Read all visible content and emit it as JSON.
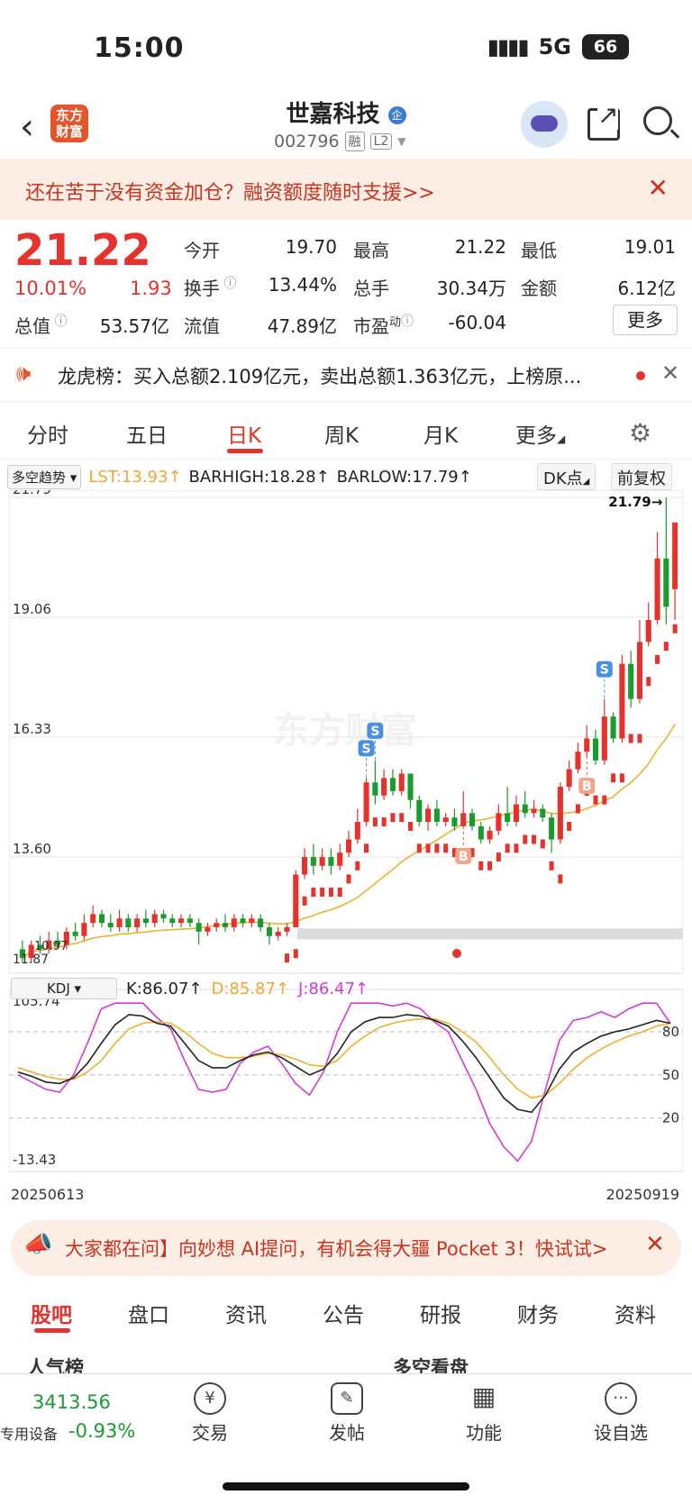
{
  "status": {
    "time": "15:00",
    "network": "5G",
    "battery": "66"
  },
  "header": {
    "logo": "东方财富",
    "name": "世嘉科技",
    "name_badge": "企",
    "code": "002796",
    "tag1": "融",
    "tag2": "L2"
  },
  "banner": {
    "text": "还在苦于没有资金加仓？融资额度随时支援>>",
    "close": "✕"
  },
  "quote": {
    "price": "21.22",
    "pct": "10.01%",
    "change": "1.93",
    "open_label": "今开",
    "open": "19.70",
    "high_label": "最高",
    "high": "21.22",
    "low_label": "最低",
    "low": "19.01",
    "turnover_label": "换手",
    "turnover": "13.44%",
    "volume_label": "总手",
    "volume": "30.34万",
    "amount_label": "金额",
    "amount": "6.12亿",
    "mcap_label": "总值",
    "mcap": "53.57亿",
    "float_label": "流值",
    "float": "47.89亿",
    "pe_label": "市盈",
    "pe_sup": "动",
    "pe": "-60.04",
    "more": "更多"
  },
  "notice": {
    "text": "龙虎榜：买入总额2.109亿元，卖出总额1.363亿元，上榜原...",
    "close": "✕"
  },
  "period_tabs": [
    "分时",
    "五日",
    "日K",
    "周K",
    "月K",
    "更多"
  ],
  "indicator": {
    "selector": "多空趋势",
    "lst": "LST:13.93↑",
    "barhigh": "BARHIGH:18.28↑",
    "barlow": "BARLOW:17.79↑",
    "dk": "DK点",
    "adjust": "前复权"
  },
  "chart_data": {
    "type": "candlestick",
    "watermark": "东方财富",
    "y_ticks": [
      "21.79",
      "19.06",
      "16.33",
      "13.60"
    ],
    "bottom_label": "11.87",
    "low_marker": "10.97",
    "high_marker": "21.79→",
    "ylim": [
      11.2,
      21.79
    ],
    "candles": [
      [
        11.5,
        11.3,
        11.7,
        11.2
      ],
      [
        11.3,
        11.6,
        11.7,
        11.2
      ],
      [
        11.6,
        11.5,
        11.8,
        11.4
      ],
      [
        11.5,
        11.7,
        11.9,
        11.4
      ],
      [
        11.7,
        11.6,
        11.9,
        11.5
      ],
      [
        11.6,
        11.9,
        12.0,
        11.5
      ],
      [
        11.9,
        11.8,
        12.1,
        11.7
      ],
      [
        11.8,
        12.1,
        12.3,
        11.7
      ],
      [
        12.1,
        12.3,
        12.5,
        12.0
      ],
      [
        12.3,
        12.1,
        12.4,
        12.0
      ],
      [
        12.1,
        12.0,
        12.3,
        11.9
      ],
      [
        12.0,
        12.2,
        12.4,
        11.9
      ],
      [
        12.2,
        12.0,
        12.3,
        11.9
      ],
      [
        12.0,
        12.2,
        12.3,
        11.9
      ],
      [
        12.2,
        12.1,
        12.4,
        12.0
      ],
      [
        12.1,
        12.3,
        12.4,
        12.0
      ],
      [
        12.3,
        12.2,
        12.4,
        12.1
      ],
      [
        12.2,
        12.1,
        12.3,
        12.0
      ],
      [
        12.1,
        12.2,
        12.3,
        12.0
      ],
      [
        12.2,
        12.1,
        12.3,
        12.0
      ],
      [
        12.1,
        11.9,
        12.2,
        11.6
      ],
      [
        11.9,
        12.0,
        12.1,
        11.8
      ],
      [
        12.0,
        12.1,
        12.2,
        11.9
      ],
      [
        12.1,
        12.0,
        12.3,
        11.9
      ],
      [
        12.0,
        12.2,
        12.3,
        11.9
      ],
      [
        12.2,
        12.1,
        12.3,
        12.0
      ],
      [
        12.1,
        12.2,
        12.3,
        12.0
      ],
      [
        12.2,
        12.0,
        12.3,
        11.9
      ],
      [
        12.0,
        11.8,
        12.1,
        11.6
      ],
      [
        11.8,
        11.9,
        12.0,
        11.7
      ],
      [
        11.9,
        12.0,
        12.1,
        11.8
      ],
      [
        12.0,
        13.2,
        13.3,
        12.0
      ],
      [
        13.2,
        13.6,
        13.8,
        13.1
      ],
      [
        13.6,
        13.4,
        13.9,
        13.2
      ],
      [
        13.4,
        13.6,
        13.8,
        13.3
      ],
      [
        13.6,
        13.4,
        13.8,
        13.2
      ],
      [
        13.4,
        13.7,
        13.9,
        13.3
      ],
      [
        13.7,
        14.0,
        14.2,
        13.6
      ],
      [
        14.0,
        14.4,
        14.7,
        13.9
      ],
      [
        14.4,
        15.3,
        15.4,
        14.3
      ],
      [
        15.3,
        15.0,
        15.8,
        14.8
      ],
      [
        15.0,
        15.4,
        15.6,
        14.9
      ],
      [
        15.4,
        15.1,
        15.6,
        15.0
      ],
      [
        15.1,
        15.5,
        15.6,
        15.0
      ],
      [
        15.5,
        14.9,
        15.5,
        14.7
      ],
      [
        14.9,
        14.4,
        15.0,
        14.3
      ],
      [
        14.4,
        14.7,
        14.8,
        14.2
      ],
      [
        14.7,
        14.4,
        14.9,
        14.3
      ],
      [
        14.4,
        14.5,
        14.6,
        14.3
      ],
      [
        14.5,
        14.3,
        14.7,
        14.2
      ],
      [
        14.3,
        14.6,
        15.1,
        14.3
      ],
      [
        14.6,
        14.3,
        14.7,
        14.2
      ],
      [
        14.3,
        14.0,
        14.4,
        13.9
      ],
      [
        14.0,
        14.2,
        14.3,
        13.9
      ],
      [
        14.2,
        14.6,
        14.8,
        14.1
      ],
      [
        14.6,
        14.4,
        15.2,
        14.3
      ],
      [
        14.4,
        14.8,
        15.0,
        14.3
      ],
      [
        14.8,
        14.6,
        15.1,
        14.5
      ],
      [
        14.6,
        14.7,
        14.9,
        14.5
      ],
      [
        14.7,
        14.5,
        14.8,
        14.4
      ],
      [
        14.5,
        14.0,
        14.6,
        13.7
      ],
      [
        14.0,
        15.2,
        15.3,
        13.9
      ],
      [
        15.2,
        15.6,
        15.8,
        15.1
      ],
      [
        15.6,
        16.0,
        16.2,
        15.5
      ],
      [
        16.0,
        16.3,
        16.6,
        15.9
      ],
      [
        16.3,
        15.8,
        16.5,
        15.7
      ],
      [
        15.8,
        16.8,
        17.2,
        15.7
      ],
      [
        16.8,
        16.3,
        16.9,
        16.2
      ],
      [
        16.3,
        18.0,
        18.2,
        16.2
      ],
      [
        18.0,
        17.2,
        18.3,
        17.0
      ],
      [
        17.2,
        18.5,
        19.0,
        17.1
      ],
      [
        18.5,
        19.0,
        19.4,
        18.4
      ],
      [
        19.0,
        20.4,
        21.0,
        18.9
      ],
      [
        20.4,
        19.3,
        21.79,
        18.9
      ],
      [
        19.7,
        21.22,
        21.22,
        19.0
      ]
    ],
    "signals_s": [
      39,
      40,
      66
    ],
    "signals_b": [
      50,
      64
    ],
    "kdj": {
      "selector": "KDJ",
      "k_text": "K:86.07↑",
      "d_text": "D:85.87↑",
      "j_text": "J:86.47↑",
      "ylim": [
        -13.43,
        105.74
      ],
      "y_top": "105.74",
      "y_bottom": "-13.43",
      "levels": [
        "80",
        "50",
        "20"
      ],
      "k": [
        52,
        49,
        45,
        44,
        48,
        58,
        72,
        85,
        92,
        91,
        86,
        84,
        72,
        60,
        55,
        55,
        60,
        64,
        66,
        62,
        56,
        50,
        54,
        65,
        80,
        87,
        90,
        90,
        92,
        91,
        88,
        84,
        74,
        62,
        48,
        34,
        26,
        24,
        36,
        54,
        66,
        72,
        77,
        80,
        82,
        85,
        88,
        86
      ],
      "d": [
        55,
        52,
        49,
        47,
        47,
        52,
        60,
        72,
        82,
        86,
        87,
        86,
        80,
        72,
        65,
        62,
        62,
        63,
        65,
        64,
        61,
        57,
        56,
        60,
        70,
        77,
        83,
        86,
        88,
        89,
        89,
        86,
        80,
        73,
        62,
        50,
        40,
        34,
        36,
        44,
        54,
        62,
        68,
        73,
        77,
        80,
        84,
        86
      ],
      "j": [
        50,
        45,
        40,
        38,
        50,
        72,
        96,
        100,
        100,
        100,
        90,
        82,
        60,
        40,
        38,
        40,
        58,
        66,
        70,
        58,
        44,
        36,
        52,
        80,
        100,
        100,
        100,
        98,
        100,
        96,
        87,
        80,
        60,
        40,
        16,
        0,
        -10,
        4,
        40,
        74,
        88,
        90,
        94,
        90,
        96,
        100,
        100,
        86
      ]
    }
  },
  "date_left": "20250613",
  "date_right": "20250919",
  "ai_banner": {
    "text": "大家都在问】向妙想 AI提问，有机会得大疆 Pocket 3！快试试>",
    "close": "✕"
  },
  "bottom_tabs": [
    "股吧",
    "盘口",
    "资讯",
    "公告",
    "研报",
    "财务",
    "资料"
  ],
  "peek": {
    "left": "人气榜",
    "right": "多空看盘"
  },
  "nav": {
    "index_value": "3413.56",
    "index_label": "专用设备",
    "index_pct": "-0.93%",
    "items": [
      "交易",
      "发帖",
      "功能",
      "设自选"
    ]
  }
}
